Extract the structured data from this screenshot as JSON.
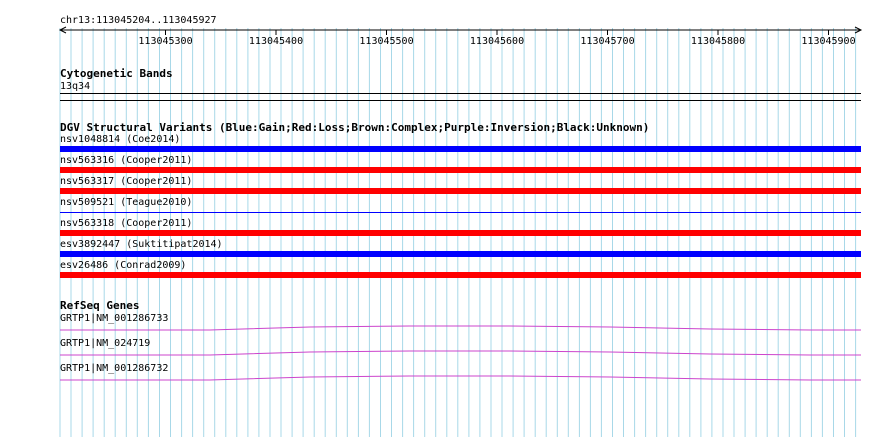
{
  "ruler": {
    "location": "chr13:113045204..113045927",
    "ticks": [
      "113045300",
      "113045400",
      "113045500",
      "113045600",
      "113045700",
      "113045800",
      "113045900"
    ]
  },
  "cytobands": {
    "title": "Cytogenetic Bands",
    "band": "13q34"
  },
  "dgv": {
    "title": "DGV Structural Variants (Blue:Gain;Red:Loss;Brown:Complex;Purple:Inversion;Black:Unknown)",
    "variants": [
      {
        "label": "nsv1048814 (Coe2014)",
        "type": "gain",
        "thick": true
      },
      {
        "label": "nsv563316 (Cooper2011)",
        "type": "loss",
        "thick": true
      },
      {
        "label": "nsv563317 (Cooper2011)",
        "type": "loss",
        "thick": true
      },
      {
        "label": "nsv509521 (Teague2010)",
        "type": "gain",
        "thick": false
      },
      {
        "label": "nsv563318 (Cooper2011)",
        "type": "loss",
        "thick": true
      },
      {
        "label": "esv3892447 (Suktitipat2014)",
        "type": "gain",
        "thick": true
      },
      {
        "label": "esv26486 (Conrad2009)",
        "type": "loss",
        "thick": true
      }
    ]
  },
  "refseq": {
    "title": "RefSeq Genes",
    "genes": [
      {
        "label": "GRTP1|NM_001286733"
      },
      {
        "label": "GRTP1|NM_024719"
      },
      {
        "label": "GRTP1|NM_001286732"
      }
    ]
  },
  "colors": {
    "gain": "#0000ff",
    "loss": "#ff0000",
    "grid": "#a8d8e8",
    "gene": "#cc44cc"
  }
}
